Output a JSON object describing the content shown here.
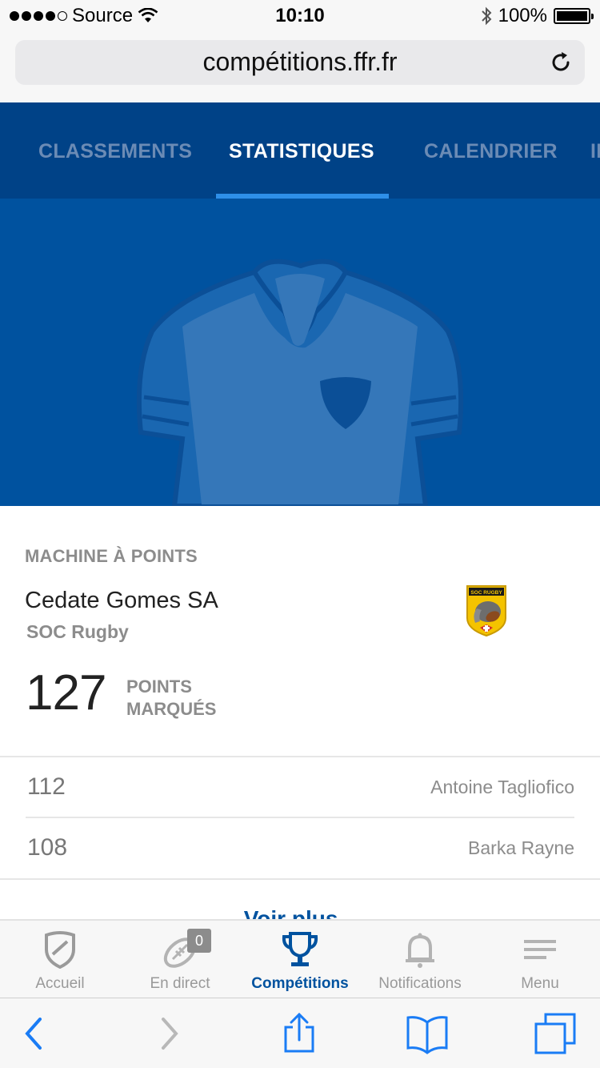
{
  "status_bar": {
    "carrier": "Source",
    "time": "10:10",
    "battery": "100%"
  },
  "browser": {
    "url": "compétitions.ffr.fr"
  },
  "tabs": [
    {
      "label": "CLASSEMENTS",
      "active": false
    },
    {
      "label": "STATISTIQUES",
      "active": true
    },
    {
      "label": "CALENDRIER",
      "active": false
    },
    {
      "label": "IN",
      "active": false
    }
  ],
  "stat": {
    "category": "MACHINE À POINTS",
    "player": "Cedate Gomes SA",
    "club": "SOC Rugby",
    "value": "127",
    "value_label_line1": "POINTS",
    "value_label_line2": "MARQUÉS",
    "others": [
      {
        "score": "112",
        "name": "Antoine Tagliofico"
      },
      {
        "score": "108",
        "name": "Barka Rayne"
      }
    ],
    "more_link": "Voir plus"
  },
  "club_logo_text": "SOC RUGBY",
  "app_nav": [
    {
      "label": "Accueil",
      "icon": "shield-icon",
      "active": false
    },
    {
      "label": "En direct",
      "icon": "rugby-ball-icon",
      "badge": "0",
      "active": false
    },
    {
      "label": "Compétitions",
      "icon": "trophy-icon",
      "active": true
    },
    {
      "label": "Notifications",
      "icon": "bell-icon",
      "active": false
    },
    {
      "label": "Menu",
      "icon": "menu-icon",
      "active": false
    }
  ],
  "colors": {
    "brand_blue": "#00529f",
    "tab_bar": "#004287",
    "active_underline": "#2e8fe8",
    "muted_text": "#8c8c8c"
  }
}
